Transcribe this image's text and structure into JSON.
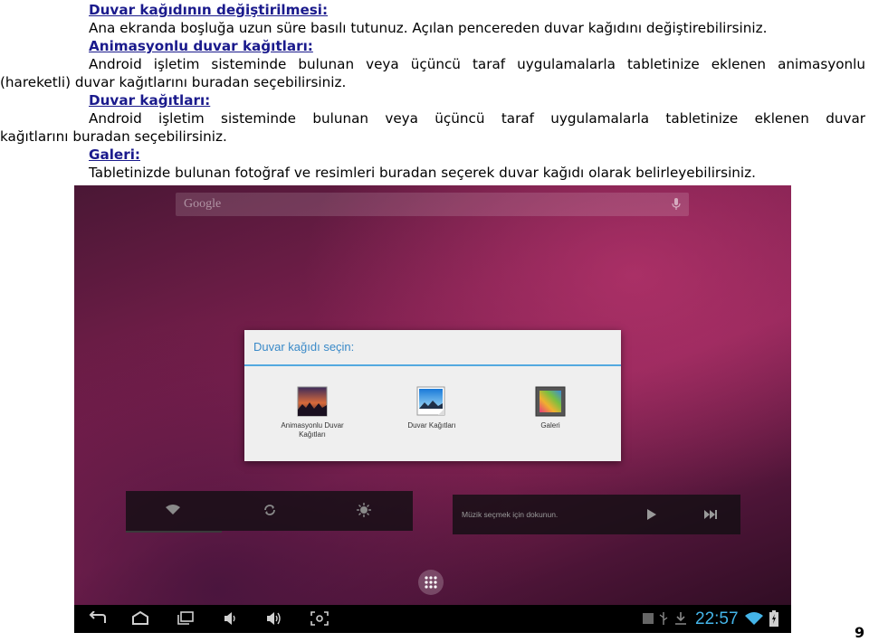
{
  "sections": [
    {
      "heading": "Duvar kağıdının değiştirilmesi:",
      "lines": [
        "Ana ekranda boşluğa uzun süre basılı tutunuz. Açılan pencereden duvar kağıdını değiştirebilirsiniz."
      ]
    },
    {
      "heading": "Animasyonlu duvar kağıtları:",
      "lines": [
        "Android işletim sisteminde bulunan veya üçüncü taraf uygulamalarla tabletinize eklenen animasyonlu",
        "(hareketli) duvar kağıtlarını buradan seçebilirsiniz."
      ]
    },
    {
      "heading": "Duvar kağıtları:",
      "lines": [
        "Android işletim sisteminde bulunan veya üçüncü taraf uygulamalarla tabletinize eklenen duvar",
        "kağıtlarını buradan seçebilirsiniz."
      ]
    },
    {
      "heading": "Galeri:",
      "lines": [
        "Tabletinizde bulunan fotoğraf ve resimleri buradan seçerek duvar kağıdı olarak belirleyebilirsiniz."
      ]
    }
  ],
  "screen": {
    "search_placeholder": "Google",
    "dialog": {
      "title": "Duvar kağıdı seçin:",
      "options": [
        {
          "label_line1": "Animasyonlu Duvar",
          "label_line2": "Kağıtları",
          "icon": "live-wallpaper-icon"
        },
        {
          "label_line1": "Duvar Kağıtları",
          "label_line2": "",
          "icon": "wallpapers-icon"
        },
        {
          "label_line1": "Galeri",
          "label_line2": "",
          "icon": "gallery-icon"
        }
      ]
    },
    "music_widget_text": "Müzik seçmek için dokunun.",
    "clock": "22:57",
    "accent_color": "#44b4e8"
  },
  "page_number": "9"
}
